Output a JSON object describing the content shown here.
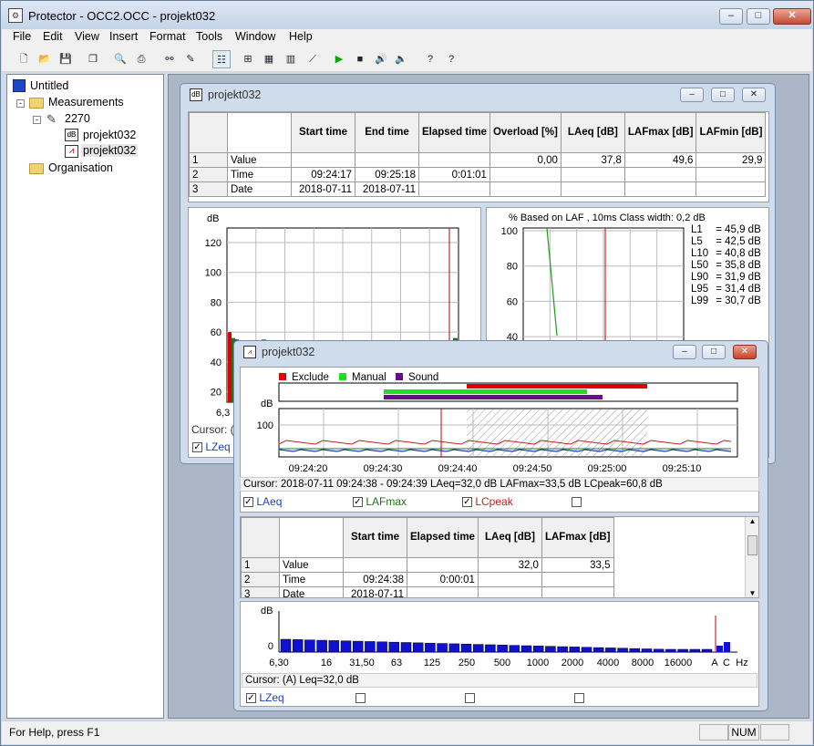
{
  "app": {
    "title": "Protector - OCC2.OCC - projekt032",
    "icon": "protector-app-icon"
  },
  "window_buttons": {
    "minimize": "–",
    "maximize": "□",
    "close": "✕"
  },
  "menu": [
    "File",
    "Edit",
    "View",
    "Insert",
    "Format",
    "Tools",
    "Window",
    "Help"
  ],
  "toolbar": [
    {
      "name": "new-icon",
      "glyph": "🗋"
    },
    {
      "name": "open-icon",
      "glyph": "📂"
    },
    {
      "name": "save-icon",
      "glyph": "💾"
    },
    {
      "name": "copy-icon",
      "glyph": "❐"
    },
    {
      "name": "print-preview-icon",
      "glyph": "🔍"
    },
    {
      "name": "print-icon",
      "glyph": "⎙"
    },
    {
      "name": "binoculars-icon",
      "glyph": "⚯"
    },
    {
      "name": "edit-icon",
      "glyph": "✎"
    },
    {
      "name": "tree-view-icon",
      "glyph": "☷"
    },
    {
      "name": "new-profile-icon",
      "glyph": "⊞"
    },
    {
      "name": "table-icon",
      "glyph": "▦"
    },
    {
      "name": "spectrum-icon",
      "glyph": "▥"
    },
    {
      "name": "graph-icon",
      "glyph": "⟋"
    },
    {
      "name": "play-icon",
      "glyph": "▶"
    },
    {
      "name": "stop-icon",
      "glyph": "■"
    },
    {
      "name": "speaker-icon",
      "glyph": "🔊"
    },
    {
      "name": "speaker-off-icon",
      "glyph": "🔈"
    },
    {
      "name": "help-icon",
      "glyph": "?"
    },
    {
      "name": "context-help-icon",
      "glyph": "?"
    }
  ],
  "tree": {
    "root": "Untitled",
    "measurements": "Measurements",
    "device": "2270",
    "file1": "projekt032",
    "file2": "projekt032",
    "organisation": "Organisation"
  },
  "status": {
    "help": "For Help, press F1",
    "num": "NUM"
  },
  "win1": {
    "title": "projekt032",
    "table": {
      "headers": [
        "Start time",
        "End time",
        "Elapsed time",
        "Overload [%]",
        "LAeq [dB]",
        "LAFmax [dB]",
        "LAFmin [dB]"
      ],
      "rows": [
        {
          "n": "1",
          "label": "Value",
          "cells": [
            "",
            "",
            "",
            "0,00",
            "37,8",
            "49,6",
            "29,9"
          ]
        },
        {
          "n": "2",
          "label": "Time",
          "cells": [
            "09:24:17",
            "09:25:18",
            "0:01:01",
            "",
            "",
            "",
            ""
          ]
        },
        {
          "n": "3",
          "label": "Date",
          "cells": [
            "2018-07-11",
            "2018-07-11",
            "",
            "",
            "",
            "",
            ""
          ]
        }
      ]
    },
    "spectrum": {
      "ylabel": "dB",
      "yticks": [
        "120",
        "100",
        "80",
        "60",
        "40",
        "20"
      ],
      "xfirst": "6,3",
      "cursor": "Cursor: (A",
      "legend": "LZeq"
    },
    "stats": {
      "header": "%   Based on LAF , 10ms   Class width: 0,2 dB",
      "yticks": [
        "100",
        "80",
        "60",
        "40"
      ],
      "levels": [
        {
          "k": "L1",
          "v": "45,9 dB"
        },
        {
          "k": "L5",
          "v": "42,5 dB"
        },
        {
          "k": "L10",
          "v": "40,8 dB"
        },
        {
          "k": "L50",
          "v": "35,8 dB"
        },
        {
          "k": "L90",
          "v": "31,9 dB"
        },
        {
          "k": "L95",
          "v": "31,4 dB"
        },
        {
          "k": "L99",
          "v": "30,7 dB"
        }
      ]
    }
  },
  "win2": {
    "title": "projekt032",
    "markers": [
      {
        "name": "Exclude",
        "color": "#e00000"
      },
      {
        "name": "Manual",
        "color": "#22dd22"
      },
      {
        "name": "Sound",
        "color": "#6a0b8a"
      }
    ],
    "profile": {
      "ylabel": "dB",
      "ytick": "100",
      "xticks": [
        "09:24:20",
        "09:24:30",
        "09:24:40",
        "09:24:50",
        "09:25:00",
        "09:25:10"
      ]
    },
    "cursor": "Cursor: 2018-07-11 09:24:38 - 09:24:39  LAeq=32,0 dB  LAFmax=33,5 dB  LCpeak=60,8 dB",
    "checks": [
      {
        "label": "LAeq",
        "color": "#1f3fc0",
        "checked": true
      },
      {
        "label": "LAFmax",
        "color": "#207020",
        "checked": true
      },
      {
        "label": "LCpeak",
        "color": "#c02020",
        "checked": true
      },
      {
        "label": "",
        "color": "#000",
        "checked": false
      }
    ],
    "table": {
      "headers": [
        "Start time",
        "Elapsed time",
        "LAeq [dB]",
        "LAFmax [dB]"
      ],
      "rows": [
        {
          "n": "1",
          "label": "Value",
          "cells": [
            "",
            "",
            "32,0",
            "33,5"
          ]
        },
        {
          "n": "2",
          "label": "Time",
          "cells": [
            "09:24:38",
            "0:00:01",
            "",
            ""
          ]
        },
        {
          "n": "3",
          "label": "Date",
          "cells": [
            "2018-07-11",
            "",
            "",
            ""
          ]
        }
      ]
    },
    "spectrum": {
      "ylabel": "dB",
      "ytick": "0",
      "xticks": [
        "6,30",
        "16",
        "31,50",
        "63",
        "125",
        "250",
        "500",
        "1000",
        "2000",
        "4000",
        "8000",
        "16000",
        "A",
        "C",
        "Hz"
      ]
    },
    "spectrum_cursor": "Cursor: (A)  Leq=32,0 dB",
    "spectrum_checks": [
      {
        "label": "LZeq",
        "checked": true
      },
      {
        "label": "",
        "checked": false
      },
      {
        "label": "",
        "checked": false
      },
      {
        "label": "",
        "checked": false
      }
    ]
  },
  "colors": {
    "accent": "#1f3fc0",
    "exclude": "#e00000",
    "manual": "#22dd22",
    "sound": "#6a0b8a",
    "bar": "#1010d0"
  }
}
